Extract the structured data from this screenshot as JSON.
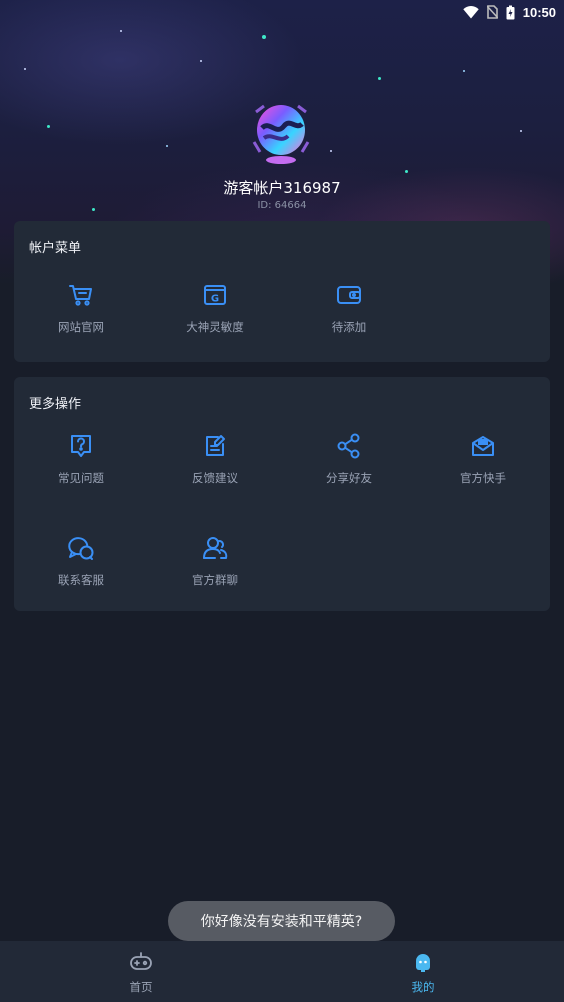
{
  "status_bar": {
    "time": "10:50",
    "icons": [
      "wifi-icon",
      "no-sim-icon",
      "battery-charging-icon"
    ]
  },
  "profile": {
    "username": "游客帐户316987",
    "id_label": "ID: 64664"
  },
  "account_menu": {
    "title": "帐户菜单",
    "items": [
      {
        "label": "网站官网",
        "icon": "cart-icon"
      },
      {
        "label": "大神灵敏度",
        "icon": "g-box-icon"
      },
      {
        "label": "待添加",
        "icon": "wallet-icon"
      }
    ]
  },
  "more_actions": {
    "title": "更多操作",
    "items": [
      {
        "label": "常见问题",
        "icon": "question-icon"
      },
      {
        "label": "反馈建议",
        "icon": "feedback-edit-icon"
      },
      {
        "label": "分享好友",
        "icon": "share-icon"
      },
      {
        "label": "官方快手",
        "icon": "envelope-icon"
      },
      {
        "label": "联系客服",
        "icon": "chat-bubbles-icon"
      },
      {
        "label": "官方群聊",
        "icon": "group-icon"
      }
    ]
  },
  "toast": {
    "message": "你好像没有安装和平精英?"
  },
  "tab_bar": {
    "tabs": [
      {
        "label": "首页",
        "icon": "gamepad-icon",
        "active": false
      },
      {
        "label": "我的",
        "icon": "robot-avatar-icon",
        "active": true
      }
    ]
  },
  "colors": {
    "accent": "#3a8ff5",
    "active_tab": "#4bb8f0",
    "inactive_tab": "#9aa3b5",
    "card_bg": "#222a37",
    "page_bg": "#181d29"
  }
}
